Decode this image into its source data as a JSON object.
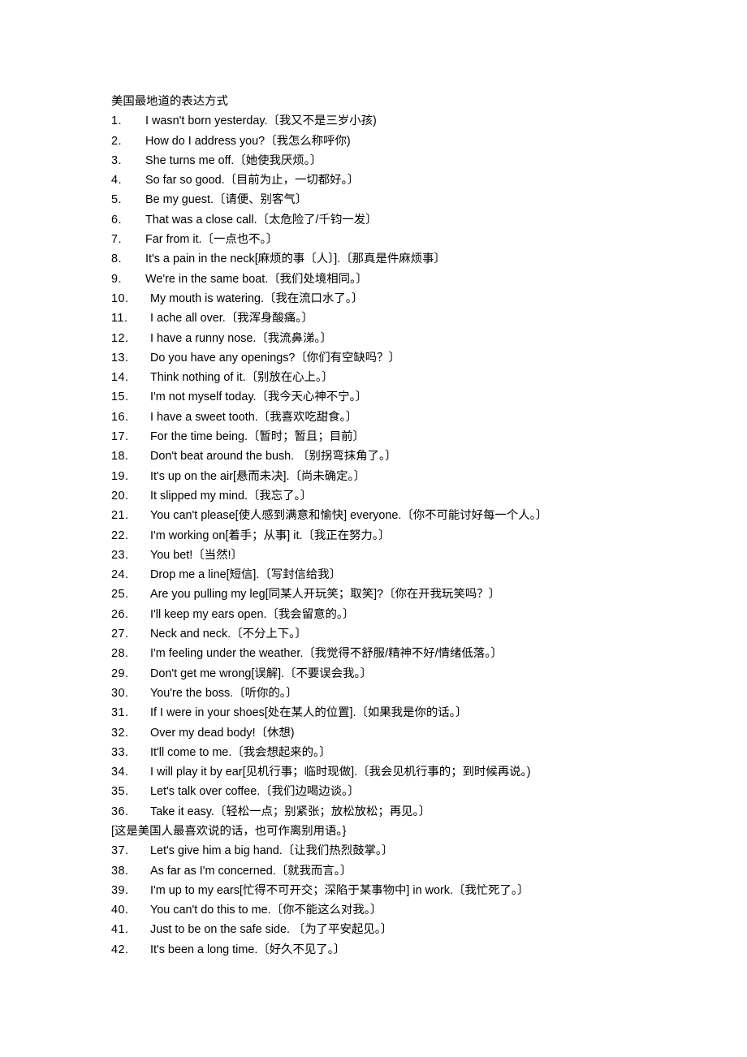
{
  "document": {
    "title": "美国最地道的表达方式",
    "background_color": "#ffffff",
    "text_color": "#000000",
    "items": [
      {
        "num": "1.",
        "text": "I wasn't born yesterday.〔我又不是三岁小孩)"
      },
      {
        "num": "2.",
        "text": "How do I address you?〔我怎么称呼你)"
      },
      {
        "num": "3.",
        "text": "She turns me off.〔她使我厌烦。〕"
      },
      {
        "num": "4.",
        "text": "So far so good.〔目前为止，一切都好。〕"
      },
      {
        "num": "5.",
        "text": "Be my guest.〔请便、别客气〕"
      },
      {
        "num": "6.",
        "text": "That was a close call.〔太危险了/千钧一发〕"
      },
      {
        "num": "7.",
        "text": "Far from it.〔一点也不。〕"
      },
      {
        "num": "8.",
        "text": "It's a pain in the neck[麻烦的事〔人〕].〔那真是件麻烦事〕"
      },
      {
        "num": "9.",
        "text": "We're in the same boat.〔我们处境相同。〕"
      },
      {
        "num": "10.",
        "text": "My mouth is watering.〔我在流口水了。〕"
      },
      {
        "num": "11.",
        "text": "I ache all over.〔我浑身酸痛。〕"
      },
      {
        "num": "12.",
        "text": "I have a runny nose.〔我流鼻涕。〕"
      },
      {
        "num": "13.",
        "text": "Do you have any openings?〔你们有空缺吗？〕"
      },
      {
        "num": "14.",
        "text": "Think nothing of it.〔别放在心上。〕"
      },
      {
        "num": "15.",
        "text": "I'm not myself today.〔我今天心神不宁。〕"
      },
      {
        "num": "16.",
        "text": "I have a sweet tooth.〔我喜欢吃甜食。〕"
      },
      {
        "num": "17.",
        "text": "For the time being.〔暂时；暂且；目前〕"
      },
      {
        "num": "18.",
        "text": "Don't beat around the bush. 〔别拐弯抹角了。〕"
      },
      {
        "num": "19.",
        "text": "It's up on the air[悬而未决].〔尚未确定。〕"
      },
      {
        "num": "20.",
        "text": "It slipped my mind.〔我忘了。〕"
      },
      {
        "num": "21.",
        "text": "You can't please[使人感到满意和愉快] everyone.〔你不可能讨好每一个人。〕"
      },
      {
        "num": "22.",
        "text": "I'm working on[着手；从事] it.〔我正在努力。〕"
      },
      {
        "num": "23.",
        "text": "You bet!〔当然!〕"
      },
      {
        "num": "24.",
        "text": "Drop me a line[短信].〔写封信给我〕"
      },
      {
        "num": "25.",
        "text": "Are you pulling my leg[同某人开玩笑；取笑]?〔你在开我玩笑吗？〕"
      },
      {
        "num": "26.",
        "text": "I'll keep my ears open.〔我会留意的。〕"
      },
      {
        "num": "27.",
        "text": "Neck and neck.〔不分上下。〕"
      },
      {
        "num": "28.",
        "text": "I'm feeling under the weather.〔我觉得不舒服/精神不好/情绪低落。〕"
      },
      {
        "num": "29.",
        "text": "Don't get me wrong[误解].〔不要误会我。〕"
      },
      {
        "num": "30.",
        "text": "You're the boss.〔听你的。〕"
      },
      {
        "num": "31.",
        "text": "If I were in your shoes[处在某人的位置].〔如果我是你的话。〕"
      },
      {
        "num": "32.",
        "text": "Over my dead body!〔休想)"
      },
      {
        "num": "33.",
        "text": "It'll come to me.〔我会想起来的。〕"
      },
      {
        "num": "34.",
        "text": "I will play it by ear[见机行事；临时现做].〔我会见机行事的；到时候再说。)"
      },
      {
        "num": "35.",
        "text": "Let's talk over coffee.〔我们边喝边谈。〕"
      },
      {
        "num": "36.",
        "text": "Take it easy.〔轻松一点；别紧张；放松放松；再见。〕"
      }
    ],
    "continuation_note": "[这是美国人最喜欢说的话，也可作离别用语。}",
    "items_after_note": [
      {
        "num": "37.",
        "text": "Let's give him a big hand.〔让我们热烈鼓掌。〕"
      },
      {
        "num": "38.",
        "text": "As far as I'm concerned.〔就我而言。〕"
      },
      {
        "num": "39.",
        "text": "I'm up to my ears[忙得不可开交；深陷于某事物中] in work.〔我忙死了。〕"
      },
      {
        "num": "40.",
        "text": "You can't do this to me.〔你不能这么对我。〕"
      },
      {
        "num": "41.",
        "text": "Just to be on the safe side. 〔为了平安起见。〕"
      },
      {
        "num": "42.",
        "text": "It's been a long time.〔好久不见了。〕"
      }
    ]
  }
}
